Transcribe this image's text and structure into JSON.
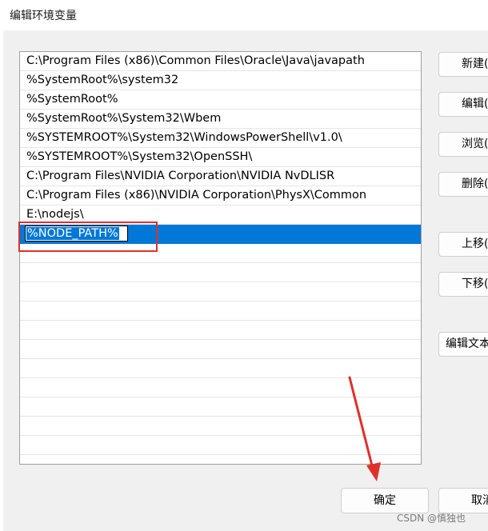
{
  "window": {
    "title": "编辑环境变量"
  },
  "paths": [
    "C:\\Program Files (x86)\\Common Files\\Oracle\\Java\\javapath",
    "%SystemRoot%\\system32",
    "%SystemRoot%",
    "%SystemRoot%\\System32\\Wbem",
    "%SYSTEMROOT%\\System32\\WindowsPowerShell\\v1.0\\",
    "%SYSTEMROOT%\\System32\\OpenSSH\\",
    "C:\\Program Files\\NVIDIA Corporation\\NVIDIA NvDLISR",
    "C:\\Program Files (x86)\\NVIDIA Corporation\\PhysX\\Common",
    "E:\\nodejs\\"
  ],
  "editing": {
    "value": "%NODE_PATH%"
  },
  "buttons": {
    "new": "新建(",
    "edit": "编辑(",
    "browse": "浏览(",
    "delete": "删除(",
    "move_up": "上移(",
    "move_down": "下移(",
    "edit_text": "编辑文本"
  },
  "footer": {
    "ok": "确定",
    "cancel": "取消"
  },
  "watermark": "CSDN @慎独也",
  "colors": {
    "selection": "#0078d7",
    "annotation": "#e0302a"
  }
}
